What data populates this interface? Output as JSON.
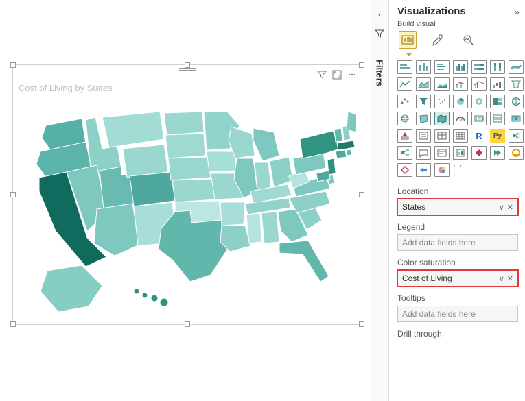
{
  "filters": {
    "label": "Filters"
  },
  "panel": {
    "title": "Visualizations",
    "build_label": "Build visual"
  },
  "visual": {
    "title": "Cost of Living by States"
  },
  "fields": {
    "location": {
      "label": "Location",
      "value": "States"
    },
    "legend": {
      "label": "Legend",
      "placeholder": "Add data fields here"
    },
    "color_saturation": {
      "label": "Color saturation",
      "value": "Cost of Living"
    },
    "tooltips": {
      "label": "Tooltips",
      "placeholder": "Add data fields here"
    },
    "drill": {
      "label": "Drill through"
    }
  },
  "icons": {
    "r_label": "R",
    "py_label": "Py",
    "more": "· · ·"
  },
  "viz_types": [
    "stacked-bar",
    "stacked-column",
    "clustered-bar",
    "clustered-column",
    "100-stacked-bar",
    "100-stacked-column",
    "ribbon",
    "line",
    "area",
    "stacked-area",
    "line-stacked-column",
    "line-clustered-column",
    "waterfall",
    "funnel",
    "scatter",
    "pie",
    "donut",
    "treemap",
    "map",
    "filled-map",
    "azure-map",
    "gauge",
    "card",
    "multi-row-card",
    "kpi",
    "slicer",
    "table",
    "matrix",
    "r-visual",
    "py-visual",
    "key-influencers",
    "decomposition-tree",
    "qna",
    "smart-narrative",
    "paginated",
    "powerapps",
    "powerautomate",
    "more-visuals",
    "more-options"
  ]
}
